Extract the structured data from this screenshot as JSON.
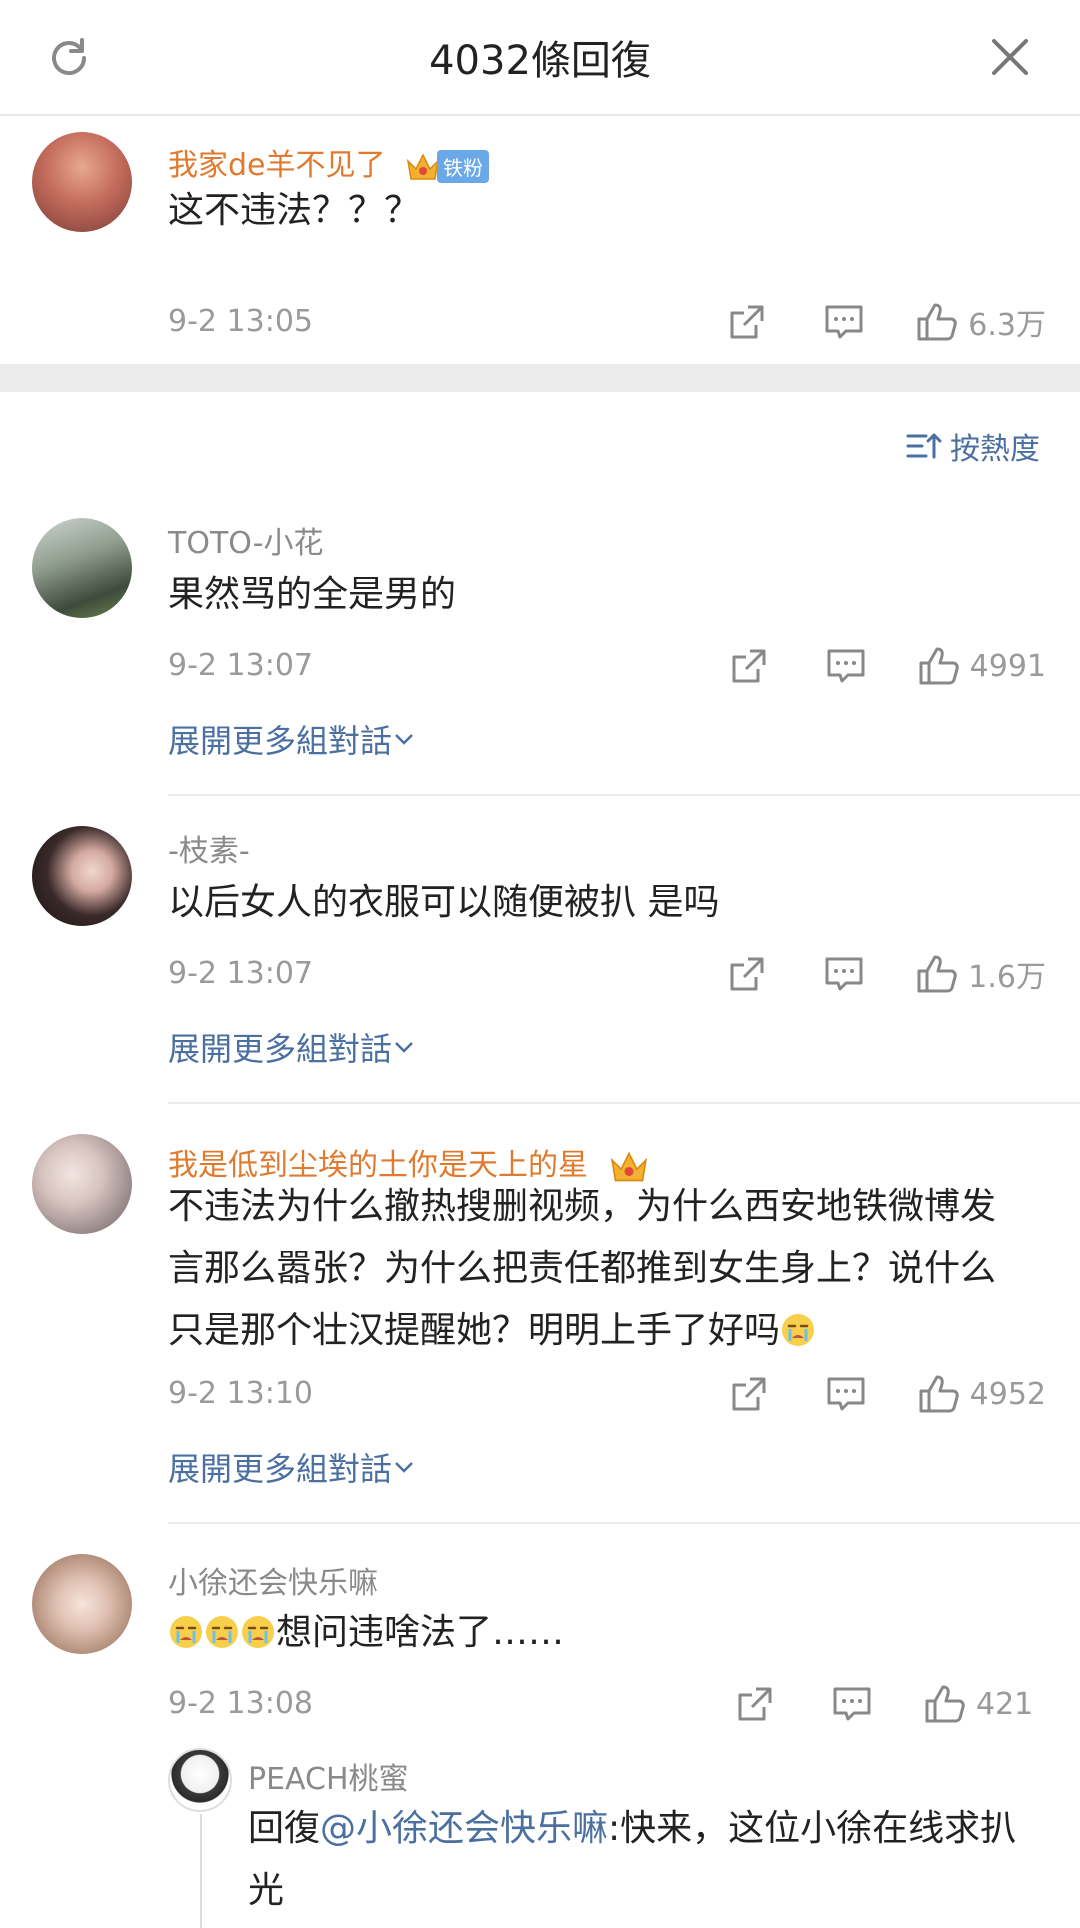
{
  "header": {
    "title": "4032條回復"
  },
  "top_comment": {
    "user": "我家de羊不见了",
    "fan_badge": "铁粉",
    "text": "这不违法？？？",
    "time": "9-2 13:05",
    "likes": "6.3万"
  },
  "sort_label": "按熱度",
  "expand_label": "展開更多組對話",
  "comments": [
    {
      "user": "TOTO-小花",
      "text": "果然骂的全是男的",
      "time": "9-2 13:07",
      "likes": "4991"
    },
    {
      "user": "-枝素-",
      "text": "以后女人的衣服可以随便被扒 是吗",
      "time": "9-2 13:07",
      "likes": "1.6万"
    },
    {
      "user": "我是低到尘埃的土你是天上的星",
      "text": "不违法为什么撤热搜删视频，为什么西安地铁微博发言那么嚣张？为什么把责任都推到女生身上？说什么只是那个壮汉提醒她？明明上手了好吗",
      "time": "9-2 13:10",
      "likes": "4952"
    },
    {
      "user": "小徐还会快乐嘛",
      "text": "想问违啥法了……",
      "time": "9-2 13:08",
      "likes": "421"
    }
  ],
  "reply": {
    "user": "PEACH桃蜜",
    "prefix": "回復",
    "mention": "@小徐还会快乐嘛",
    "text": ":快来，这位小徐在线求扒光"
  },
  "colors": {
    "link": "#4a6fa0",
    "vip_name": "#e07a2e",
    "fan_badge": "#6aa8e8"
  }
}
